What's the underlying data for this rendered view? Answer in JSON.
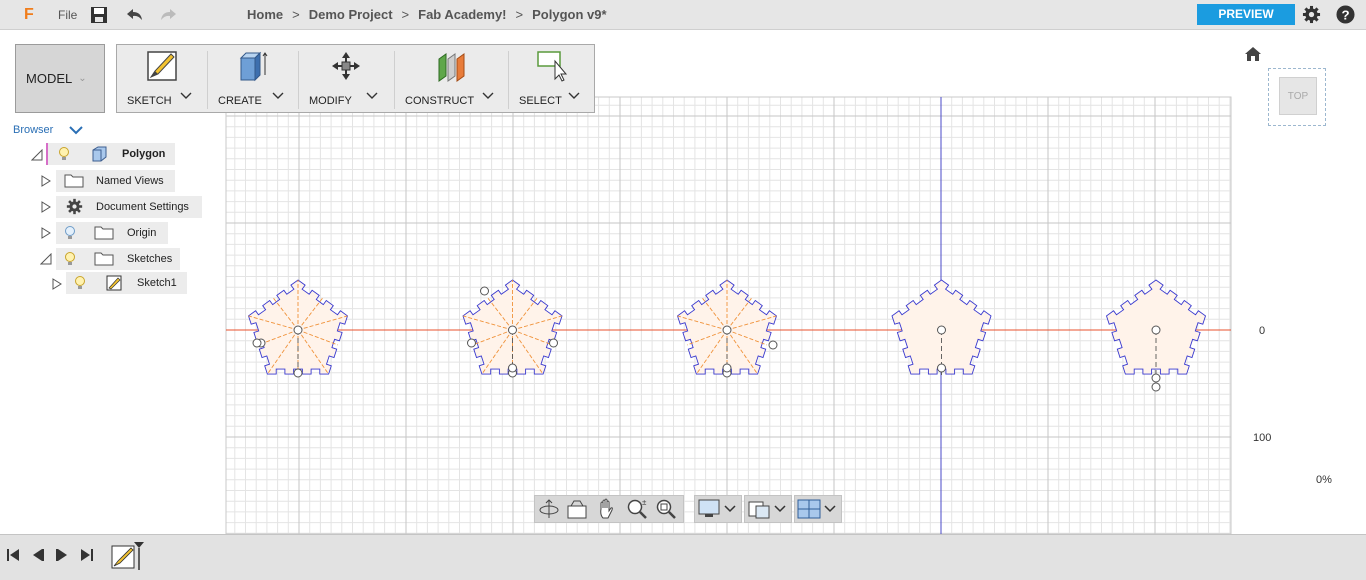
{
  "titlebar": {
    "logo": "F",
    "file_label": "File",
    "breadcrumb": [
      "Home",
      "Demo Project",
      "Fab Academy!",
      "Polygon v9*"
    ],
    "breadcrumb_sep": ">",
    "preview_label": "PREVIEW",
    "icons": [
      "save-icon",
      "undo-icon",
      "redo-icon",
      "gear-icon",
      "help-icon"
    ]
  },
  "workspace": {
    "label": "MODEL"
  },
  "toolbar": {
    "items": [
      {
        "label": "SKETCH",
        "icon": "sketch-icon"
      },
      {
        "label": "CREATE",
        "icon": "box-icon"
      },
      {
        "label": "MODIFY",
        "icon": "move-arrows-icon"
      },
      {
        "label": "CONSTRUCT",
        "icon": "plane-icon"
      },
      {
        "label": "SELECT",
        "icon": "select-cursor-icon"
      }
    ]
  },
  "browser": {
    "title": "Browser",
    "items": [
      {
        "label": "Polygon"
      },
      {
        "label": "Named Views"
      },
      {
        "label": "Document Settings"
      },
      {
        "label": "Origin"
      },
      {
        "label": "Sketches"
      },
      {
        "label": "Sketch1"
      }
    ]
  },
  "viewport": {
    "axis_labels": [
      "0",
      "100"
    ],
    "zoom_percent": "0%",
    "viewcube_face": "TOP",
    "polygon_count": 5,
    "colors": {
      "x_axis": "#e8502e",
      "y_axis": "#4a4ac8",
      "profile_fill": "#fff3ea",
      "outline": "#3a3acf",
      "construction": "#f0923a"
    }
  },
  "navbar": {
    "icons": [
      "orbit-icon",
      "look-at-icon",
      "pan-hand-icon",
      "zoom-icon",
      "zoom-window-icon",
      "display-settings-icon",
      "visual-style-icon",
      "grid-settings-icon"
    ]
  },
  "timeline": {
    "icons": [
      "first-frame-icon",
      "prev-frame-icon",
      "play-icon",
      "last-frame-icon",
      "sketch-feature-icon"
    ]
  }
}
